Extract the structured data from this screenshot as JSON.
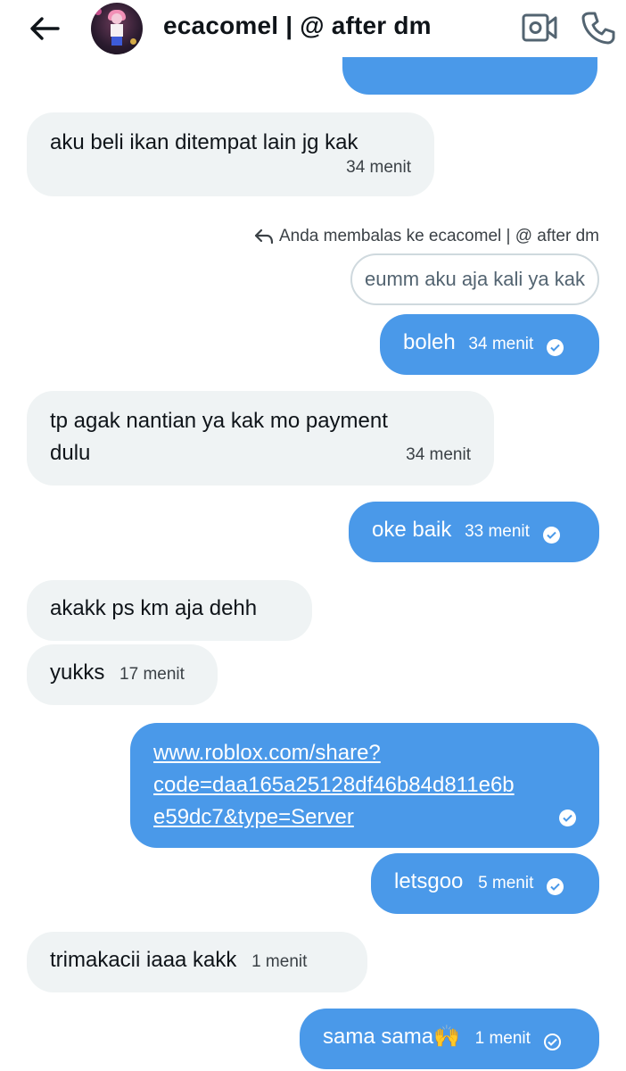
{
  "header": {
    "title": "ecacomel | @ after dm"
  },
  "icons": {
    "back": "arrow-left-icon",
    "video": "video-camera-icon",
    "call": "phone-icon",
    "reply": "reply-arrow-icon",
    "read": "check-circle-icon"
  },
  "colors": {
    "outgoing_bubble": "#4a99e9",
    "incoming_bubble": "#eff3f4",
    "text": "#0f1419",
    "muted": "#536471"
  },
  "reply": {
    "label": "Anda membalas ke ecacomel | @ after dm",
    "quoted": "eumm aku aja kali ya kak"
  },
  "messages": [
    {
      "dir": "in",
      "text": "aku beli ikan ditempat lain jg kak",
      "time": "34 menit"
    },
    {
      "dir": "out",
      "text": "boleh",
      "time": "34 menit"
    },
    {
      "dir": "in",
      "text": "tp agak nantian ya kak mo payment dulu",
      "time": "34 menit"
    },
    {
      "dir": "out",
      "text": "oke baik",
      "time": "33 menit"
    },
    {
      "dir": "in",
      "text": "akakk ps km aja dehh",
      "time": ""
    },
    {
      "dir": "in",
      "text": "yukks",
      "time": "17 menit"
    },
    {
      "dir": "out",
      "text": "www.roblox.com/share?code=daa165a25128df46b84d811e6be59dc7&type=Server",
      "time": ""
    },
    {
      "dir": "out",
      "text": "letsgoo",
      "time": "5 menit"
    },
    {
      "dir": "in",
      "text": "trimakacii iaaa kakk",
      "time": "1 menit"
    },
    {
      "dir": "out",
      "text": "sama sama🙌",
      "time": "1 menit"
    }
  ],
  "link_lines": [
    "www.roblox.com/share?",
    "code=daa165a25128df46b84d811e6b",
    "e59dc7&type=Server"
  ],
  "wrapped_lines": {
    "msg2_line1": "tp agak nantian ya kak mo payment",
    "msg2_line2": "dulu"
  }
}
